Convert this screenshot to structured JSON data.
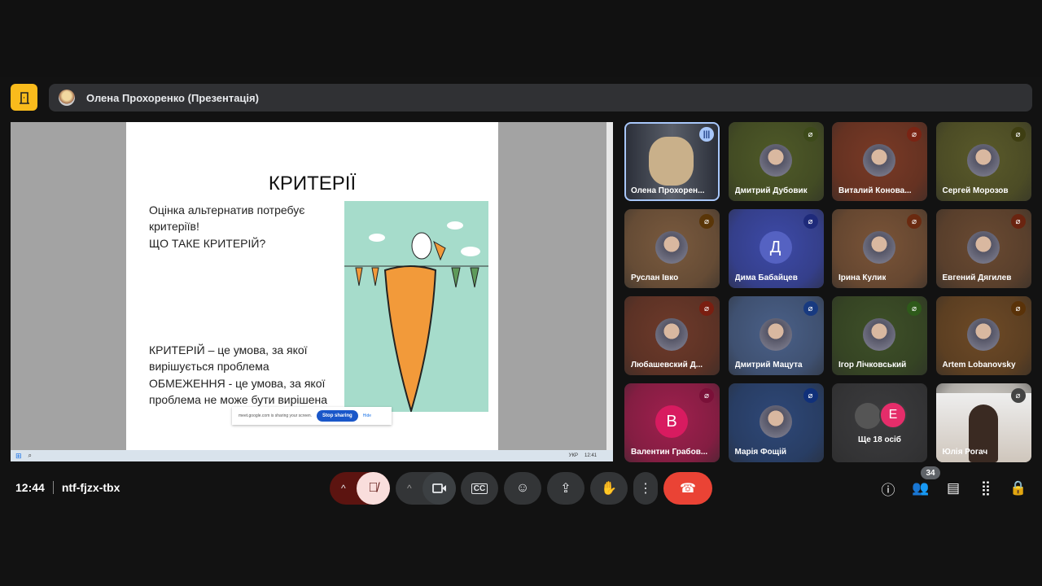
{
  "presenter": {
    "title": "Олена Прохоренко (Презентація)"
  },
  "slide": {
    "title": "КРИТЕРІЇ",
    "line1": "Оцінка альтернатив потребує",
    "line2": "критеріїв!",
    "line3": "ЩО ТАКЕ КРИТЕРІЙ?",
    "def1a": "КРИТЕРІЙ – це умова, за якої",
    "def1b": "вирішується проблема",
    "def2a": "ОБМЕЖЕННЯ - це умова, за якої",
    "def2b": "проблема не може бути вирішена"
  },
  "share_bar": {
    "text": "meet.google.com is sharing your screen.",
    "stop": "Stop sharing",
    "hide": "Hide"
  },
  "taskbar": {
    "lang": "УКР",
    "time": "12:41"
  },
  "participants": [
    {
      "name": "Олена Прохорен...",
      "bg": "#3a3f4a",
      "speaking": true
    },
    {
      "name": "Дмитрий Дубовик",
      "bg": "#4f5a28",
      "mic": "#3d4a1a"
    },
    {
      "name": "Виталий Конова...",
      "bg": "#7a3a26",
      "mic": "#7a2414"
    },
    {
      "name": "Сергей Морозов",
      "bg": "#5a5a2a",
      "mic": "#3e3e12"
    },
    {
      "name": "Руслан Івко",
      "bg": "#7a5a3e",
      "mic": "#5a3608"
    },
    {
      "name": "Дима Бабайцев",
      "bg": "#3d4aa8",
      "initial": "Д",
      "avbg": "#5562c2",
      "mic": "#1e2a7a"
    },
    {
      "name": "Ірина Кулик",
      "bg": "#7a5438",
      "mic": "#6a2a10"
    },
    {
      "name": "Евгений Дягилев",
      "bg": "#6a4a32",
      "mic": "#6a2410"
    },
    {
      "name": "Любашевский Д...",
      "bg": "#6e3a2a",
      "mic": "#7a1e10"
    },
    {
      "name": "Дмитрий Мацута",
      "bg": "#4a6088",
      "mic": "#183a80"
    },
    {
      "name": "Ігор Лічковський",
      "bg": "#3e5028",
      "mic": "#2e5a1a"
    },
    {
      "name": "Artem Lobanovsky",
      "bg": "#6e4a26",
      "mic": "#5a3208"
    },
    {
      "name": "Валентин Грабов...",
      "bg": "#a0204e",
      "initial": "В",
      "avbg": "#d81b60",
      "mic": "#7a1038"
    },
    {
      "name": "Марія Фощій",
      "bg": "#2e4878",
      "mic": "#10307a"
    },
    {
      "name": "Ще 18 осіб",
      "bg": "#3c3c3e",
      "more": true,
      "initial": "Е"
    },
    {
      "name": "Юлія Рогач",
      "bg": "#d8d4ce",
      "mic": "#444"
    }
  ],
  "footer": {
    "time": "12:44",
    "meeting_code": "ntf-fjzx-tbx",
    "participant_count": "34"
  },
  "colors": {
    "accent": "#f9bb1c",
    "end_call": "#ea4335",
    "mic_off": "#f9dedc"
  }
}
